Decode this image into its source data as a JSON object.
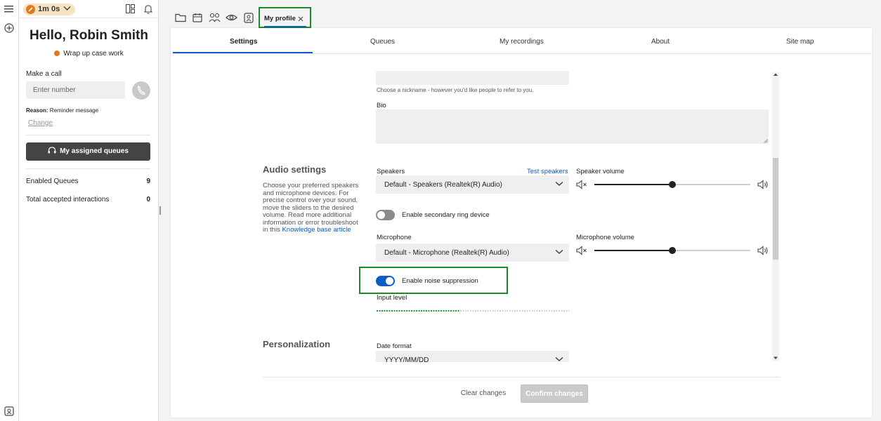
{
  "timer": {
    "value": "1m 0s"
  },
  "profile": {
    "greeting": "Hello, Robin Smith",
    "status": "Wrap up case work"
  },
  "make_call": {
    "label": "Make a call",
    "placeholder": "Enter number",
    "reason_label": "Reason:",
    "reason_value": "Reminder message",
    "change_link": "Change"
  },
  "queues_button": "My assigned queues",
  "stats": [
    {
      "label": "Enabled Queues",
      "value": "9"
    },
    {
      "label": "Total accepted interactions",
      "value": "0"
    }
  ],
  "open_tab": {
    "label": "My profile"
  },
  "subtabs": [
    "Settings",
    "Queues",
    "My recordings",
    "About",
    "Site map"
  ],
  "nickname": {
    "help": "Choose a nickname - however you'd like people to refer to you."
  },
  "bio": {
    "label": "Bio"
  },
  "audio": {
    "title": "Audio settings",
    "description": "Choose your preferred speakers and microphone devices. For precise control over your sound, move the sliders to the desired volume. Read more additional information or error troubleshoot in this ",
    "kb_link": "Knowledge base article",
    "speakers_label": "Speakers",
    "test_speakers": "Test speakers",
    "speakers_value": "Default - Speakers (Realtek(R) Audio)",
    "speaker_volume_label": "Speaker volume",
    "speaker_volume": 0.5,
    "secondary_ring": {
      "label": "Enable secondary ring device",
      "on": false
    },
    "microphone_label": "Microphone",
    "microphone_value": "Default - Microphone (Realtek(R) Audio)",
    "microphone_volume_label": "Microphone volume",
    "microphone_volume": 0.5,
    "noise_suppression": {
      "label": "Enable noise suppression",
      "on": true
    },
    "input_level_label": "Input level",
    "input_level": 0.43
  },
  "personalization": {
    "title": "Personalization",
    "date_format_label": "Date format",
    "date_format_value": "YYYY/MM/DD"
  },
  "actions": {
    "clear": "Clear changes",
    "confirm": "Confirm changes"
  },
  "colors": {
    "accent": "#0b5cc6",
    "highlight": "#1e8a2c",
    "status": "#e2781b"
  }
}
